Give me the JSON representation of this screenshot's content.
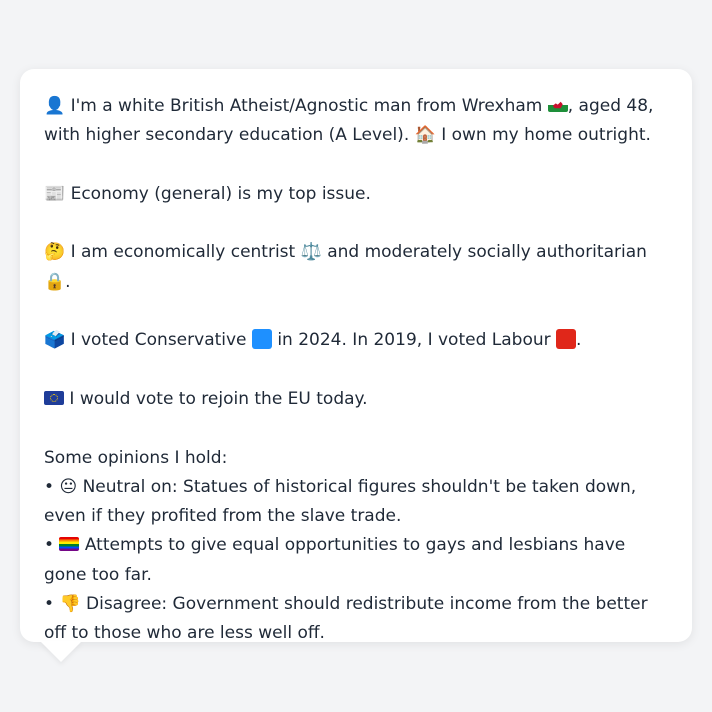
{
  "profile": {
    "intro": {
      "person_icon": "👤",
      "text_a": "I'm a white British Atheist/Agnostic man from Wrexham",
      "text_b": ", aged 48, with higher secondary education (A Level).",
      "home_icon": "🏠",
      "text_c": "I own my home outright."
    },
    "issue": {
      "icon": "📰",
      "text": "Economy (general) is my top issue."
    },
    "ideology": {
      "icon": "🤔",
      "text_a": "I am economically centrist",
      "scale_icon": "⚖️",
      "text_b": "and moderately socially authoritarian",
      "lock_icon": "🔒",
      "text_c": "."
    },
    "votes": {
      "icon": "🗳️",
      "text_a": "I voted Conservative",
      "text_b": "in 2024. In 2019, I voted Labour",
      "text_c": ".",
      "conservative_color": "#1e90ff",
      "labour_color": "#e0271a"
    },
    "eu": {
      "text": "I would vote to rejoin the EU today."
    },
    "opinions": {
      "heading": "Some opinions I hold:",
      "bullet": "•",
      "items": [
        {
          "icon": "😐",
          "text": "Neutral on: Statues of historical figures shouldn't be taken down, even if they profited from the slave trade."
        },
        {
          "icon": "rainbow-flag",
          "text": "Attempts to give equal opportunities to gays and lesbians have gone too far."
        },
        {
          "icon": "👎",
          "text": "Disagree: Government should redistribute income from the better off to those who are less well off."
        }
      ]
    }
  }
}
